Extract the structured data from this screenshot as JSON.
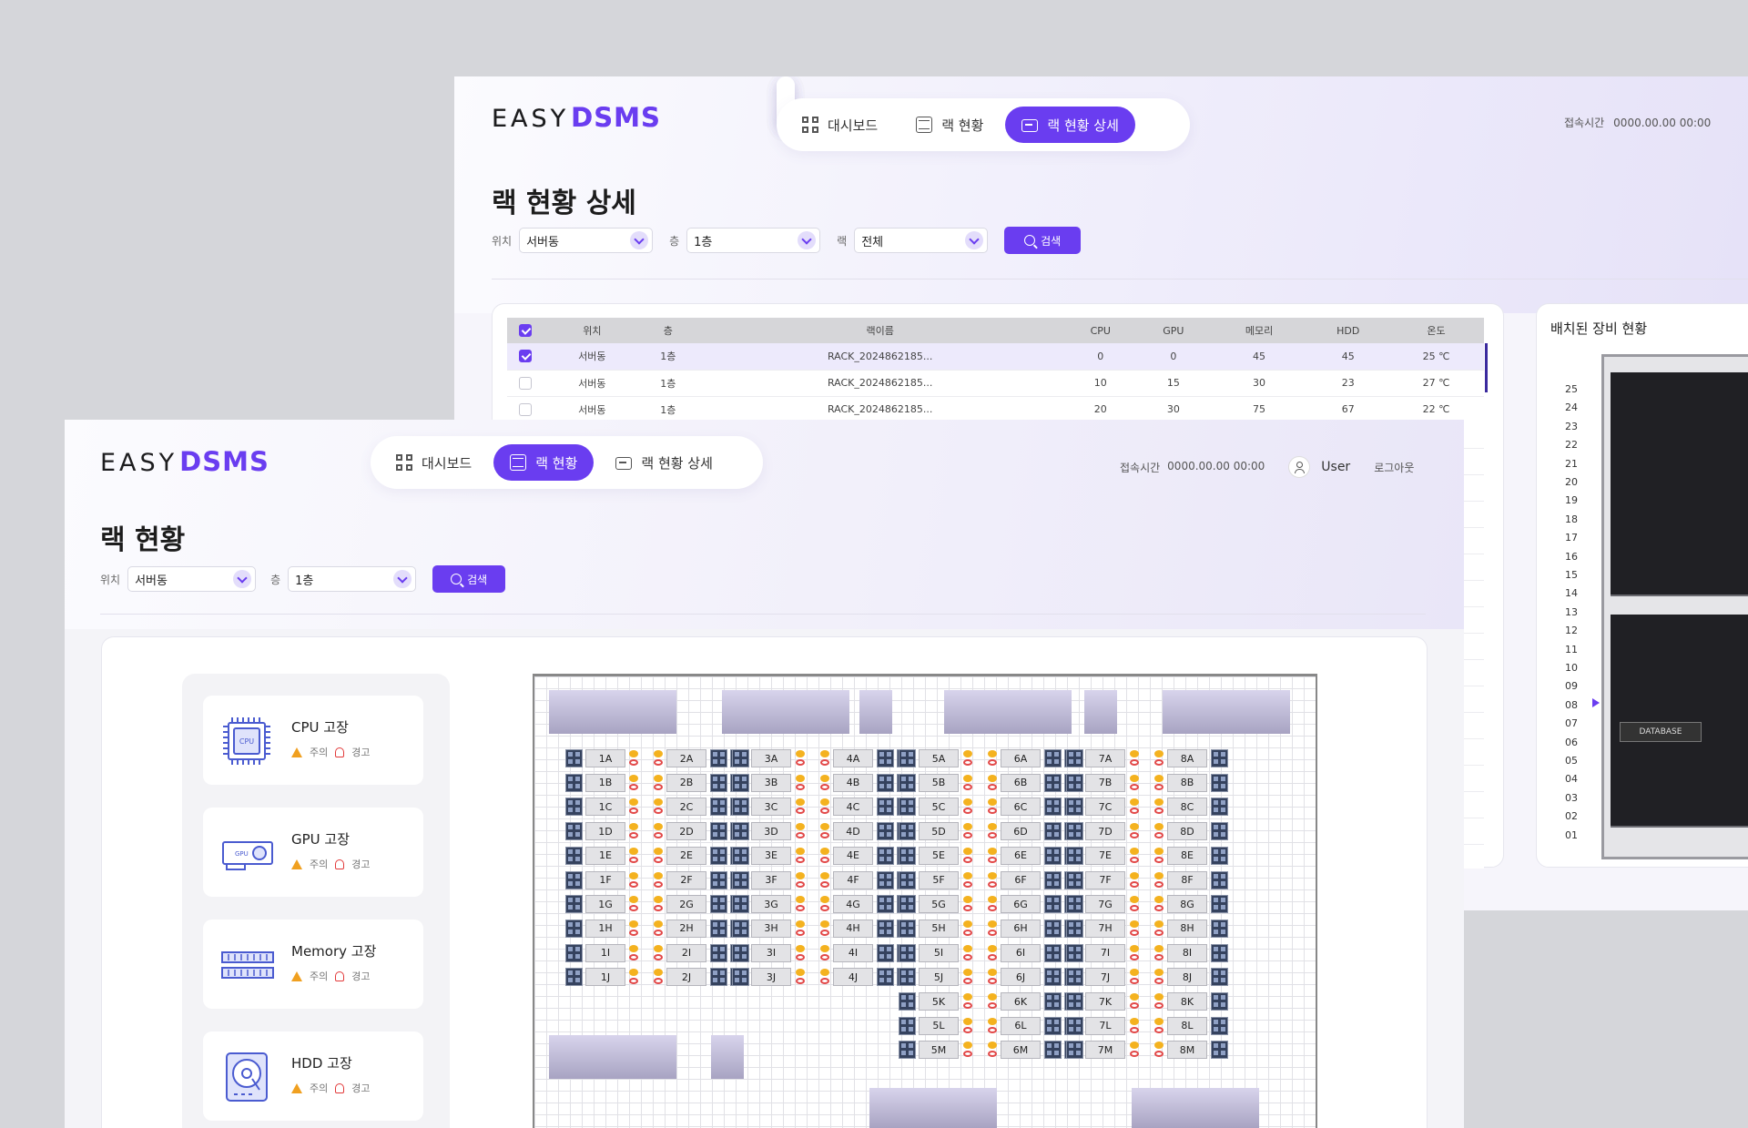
{
  "brand": {
    "easy": "EASY",
    "dsms": "DSMS"
  },
  "nav": {
    "dashboard": "대시보드",
    "rack_status": "랙 현황",
    "rack_detail": "랙 현황 상세"
  },
  "header": {
    "access_label": "접속시간",
    "access_time": "0000.00.00 00:00",
    "user": "User",
    "logout": "로그아웃"
  },
  "detail_page": {
    "title": "랙 현황 상세",
    "filters": [
      {
        "label": "위치",
        "value": "서버동"
      },
      {
        "label": "층",
        "value": "1층"
      },
      {
        "label": "랙",
        "value": "전체"
      }
    ],
    "search_label": "검색",
    "table": {
      "columns": [
        "위치",
        "층",
        "랙이름",
        "CPU",
        "GPU",
        "메모리",
        "HDD",
        "온도"
      ],
      "rows": [
        [
          "서버동",
          "1층",
          "RACK_2024862185...",
          "0",
          "0",
          "45",
          "45",
          "25 ℃"
        ],
        [
          "서버동",
          "1층",
          "RACK_2024862185...",
          "10",
          "15",
          "30",
          "23",
          "27 ℃"
        ],
        [
          "서버동",
          "1층",
          "RACK_2024862185...",
          "20",
          "30",
          "75",
          "67",
          "22 ℃"
        ]
      ]
    },
    "rack_panel_title": "배치된 장비 현황",
    "rack_units": [
      "25",
      "24",
      "23",
      "22",
      "21",
      "20",
      "19",
      "18",
      "17",
      "16",
      "15",
      "14",
      "13",
      "12",
      "11",
      "10",
      "09",
      "08",
      "07",
      "06",
      "05",
      "04",
      "03",
      "02",
      "01"
    ],
    "database_label": "DATABASE"
  },
  "status_page": {
    "title": "랙 현황",
    "filters": [
      {
        "label": "위치",
        "value": "서버동"
      },
      {
        "label": "층",
        "value": "1층"
      }
    ],
    "search_label": "검색",
    "fault_cards": [
      {
        "name": "CPU 고장",
        "icon": "cpu-icon",
        "caution": "주의",
        "warning": "경고"
      },
      {
        "name": "GPU 고장",
        "icon": "gpu-icon",
        "caution": "주의",
        "warning": "경고"
      },
      {
        "name": "Memory 고장",
        "icon": "memory-icon",
        "caution": "주의",
        "warning": "경고"
      },
      {
        "name": "HDD 고장",
        "icon": "hdd-icon",
        "caution": "주의",
        "warning": "경고"
      }
    ],
    "rack_rows": [
      "A",
      "B",
      "C",
      "D",
      "E",
      "F",
      "G",
      "H",
      "I",
      "J",
      "K",
      "L",
      "M"
    ],
    "rack_columns": [
      "1",
      "2",
      "3",
      "4",
      "5",
      "6",
      "7",
      "8"
    ],
    "cpu_chip_label": "CPU",
    "gpu_chip_label": "GPU"
  },
  "colors": {
    "accent": "#6a3df0",
    "caution": "#f0a020",
    "warning": "#e23a3a"
  }
}
